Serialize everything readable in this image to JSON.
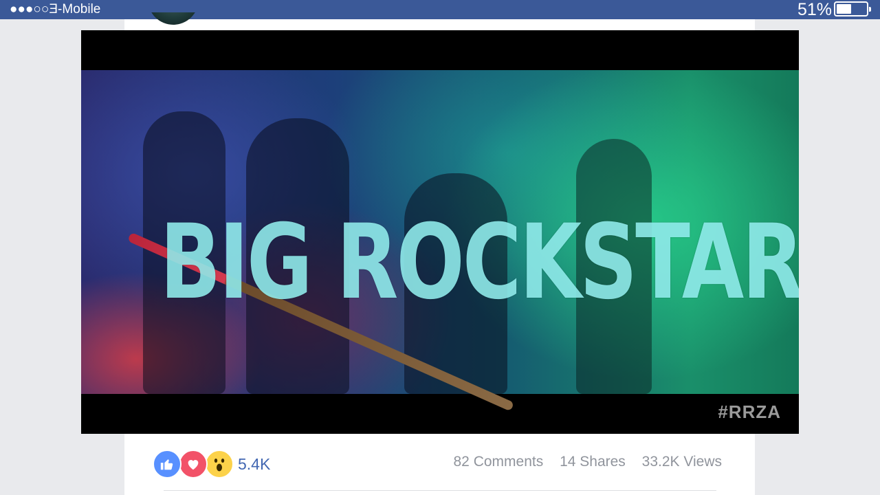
{
  "status_bar": {
    "carrier": "●●●○○Ǝ-Mobile",
    "battery_percent": "51%",
    "battery_level": 0.51,
    "color": "#3b5998"
  },
  "video": {
    "headline": "BIG ROCKSTAR",
    "watermark": "#RRZA"
  },
  "stats": {
    "reaction_icons": [
      "like-icon",
      "love-icon",
      "wow-icon"
    ],
    "reactions_count": "5.4K",
    "comments": "82 Comments",
    "shares": "14 Shares",
    "views": "33.2K Views"
  },
  "colors": {
    "like": "#5890ff",
    "love": "#f25268",
    "wow": "#fcd24a",
    "link": "#4267b2",
    "muted": "#90949c"
  }
}
